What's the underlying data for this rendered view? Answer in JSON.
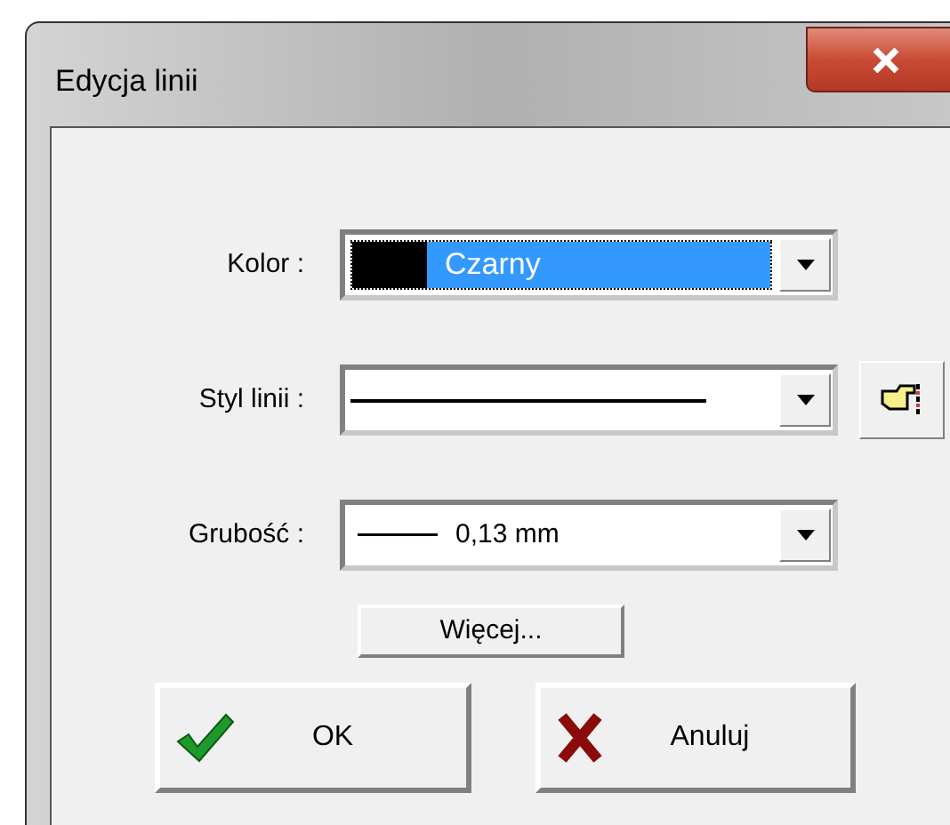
{
  "window": {
    "title": "Edycja linii"
  },
  "fields": [
    {
      "kind": "color",
      "label": "Kolor :",
      "value": "Czarny",
      "color": "#000000",
      "focused": true,
      "picker": false
    },
    {
      "kind": "line-style",
      "label": "Styl linii :",
      "focused": false,
      "picker": true
    },
    {
      "kind": "thickness",
      "label": "Grubość :",
      "value": "0,13 mm",
      "focused": false,
      "picker": false
    }
  ],
  "more_button": "Więcej...",
  "buttons": [
    {
      "kind": "ok",
      "label": "OK"
    },
    {
      "kind": "cancel",
      "label": "Anuluj"
    }
  ]
}
